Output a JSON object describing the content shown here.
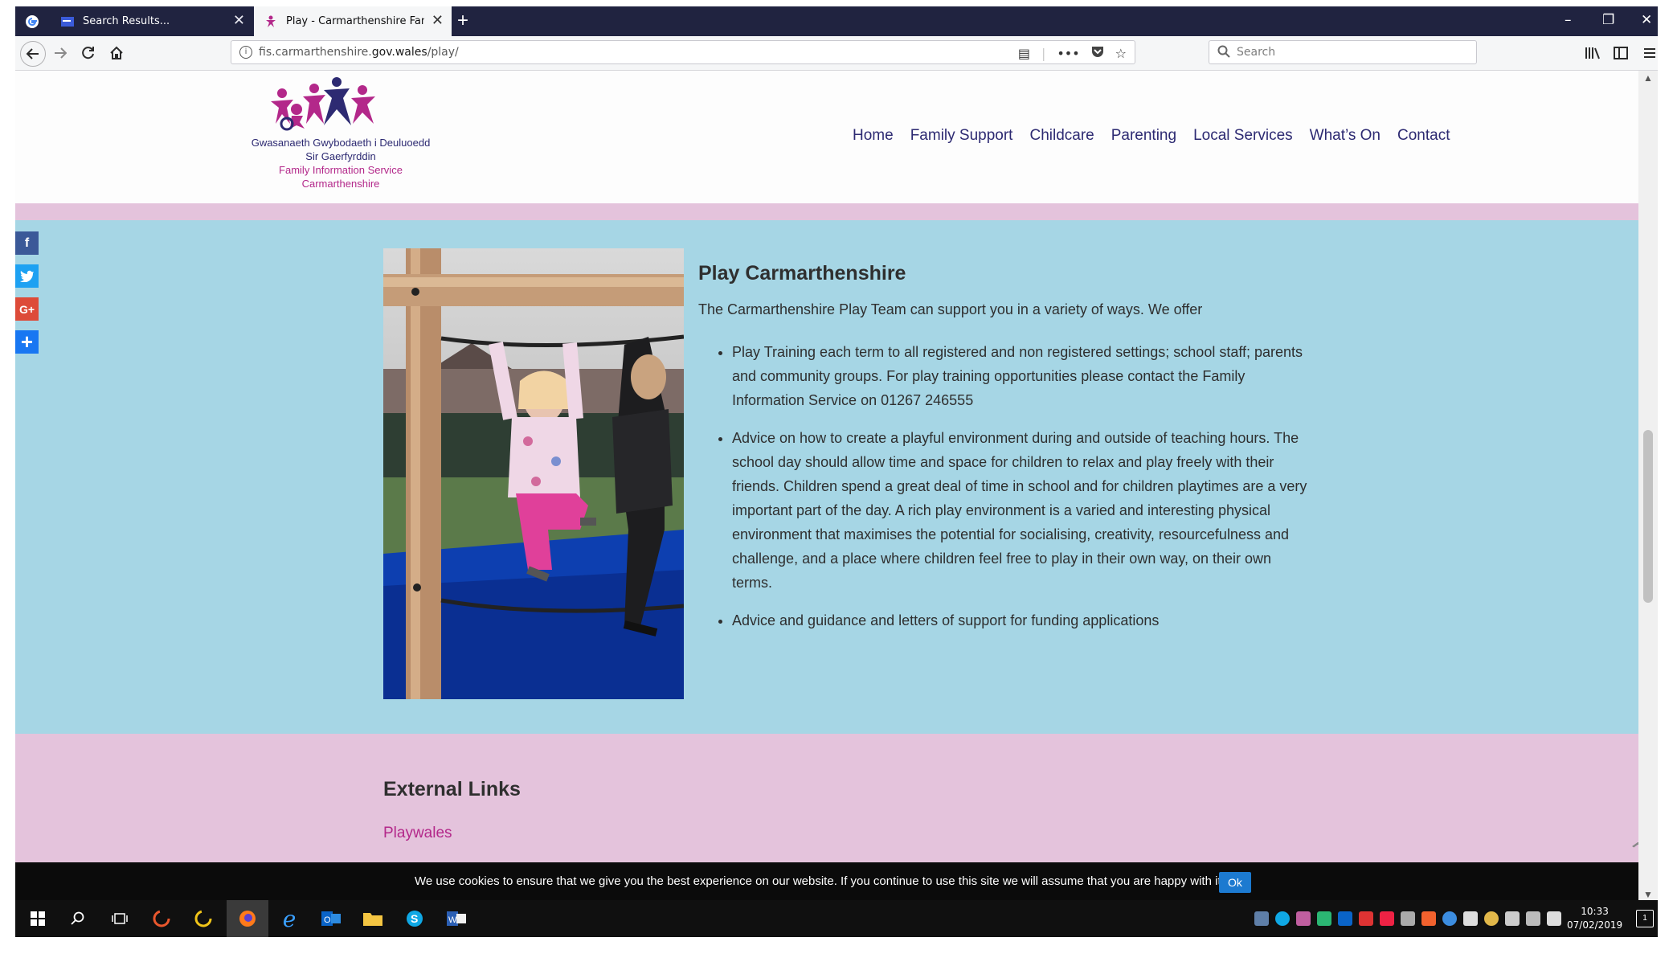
{
  "browser": {
    "tabs": [
      {
        "title": "Search Results...",
        "active": false
      },
      {
        "title": "Play - Carmarthenshire Family I",
        "active": true
      }
    ],
    "url_prefix": "fis.carmarthenshire.",
    "url_domain": "gov.wales",
    "url_path": "/play/",
    "search_placeholder": "Search",
    "icons": [
      "back-arrow-icon",
      "forward-arrow-icon",
      "reload-icon",
      "home-icon",
      "info-icon",
      "reader-view-icon",
      "more-icon",
      "pocket-icon",
      "bookmark-star-icon",
      "library-icon",
      "sidebar-icon",
      "menu-icon"
    ]
  },
  "site": {
    "logo": {
      "welsh_line1": "Gwasanaeth Gwybodaeth i Deuluoedd",
      "welsh_line2": "Sir Gaerfyrddin",
      "english_line1": "Family Information Service",
      "english_line2": "Carmarthenshire"
    },
    "nav": [
      "Home",
      "Family Support",
      "Childcare",
      "Parenting",
      "Local Services",
      "What’s On",
      "Contact"
    ],
    "colors": {
      "brand_navy": "#2d2a72",
      "brand_pink": "#b3288a",
      "section_blue": "#a6d6e5",
      "section_pink": "#e4c3dc"
    }
  },
  "main": {
    "title": "Play Carmarthenshire",
    "intro": "The Carmarthenshire Play Team can support you in a variety of ways. We offer",
    "bullets": [
      "Play Training each term to all registered and non registered settings; school staff; parents and community groups. For play training opportunities please contact the Family Information Service on 01267 246555",
      "Advice on how to create a playful environment during and outside of teaching hours. The school day should allow time and space for children to relax and play freely with their friends. Children spend a great deal of time in school and for children playtimes are a very important part of the day. A rich play environment is a varied and interesting physical environment that maximises the potential for socialising, creativity, resourcefulness and challenge, and a place where children feel free to play in their own way, on their own terms.",
      "Advice and guidance and letters of support for funding applications"
    ]
  },
  "external": {
    "heading": "External Links",
    "links": [
      "Playwales"
    ]
  },
  "social": [
    "facebook-icon",
    "twitter-icon",
    "google-plus-icon",
    "share-icon"
  ],
  "cookie": {
    "text": "We use cookies to ensure that we give you the best experience on our website. If you continue to use this site we will assume that you are happy with it.",
    "button": "Ok"
  },
  "taskbar": {
    "time": "10:33",
    "date": "07/02/2019",
    "notification_count": "1"
  }
}
